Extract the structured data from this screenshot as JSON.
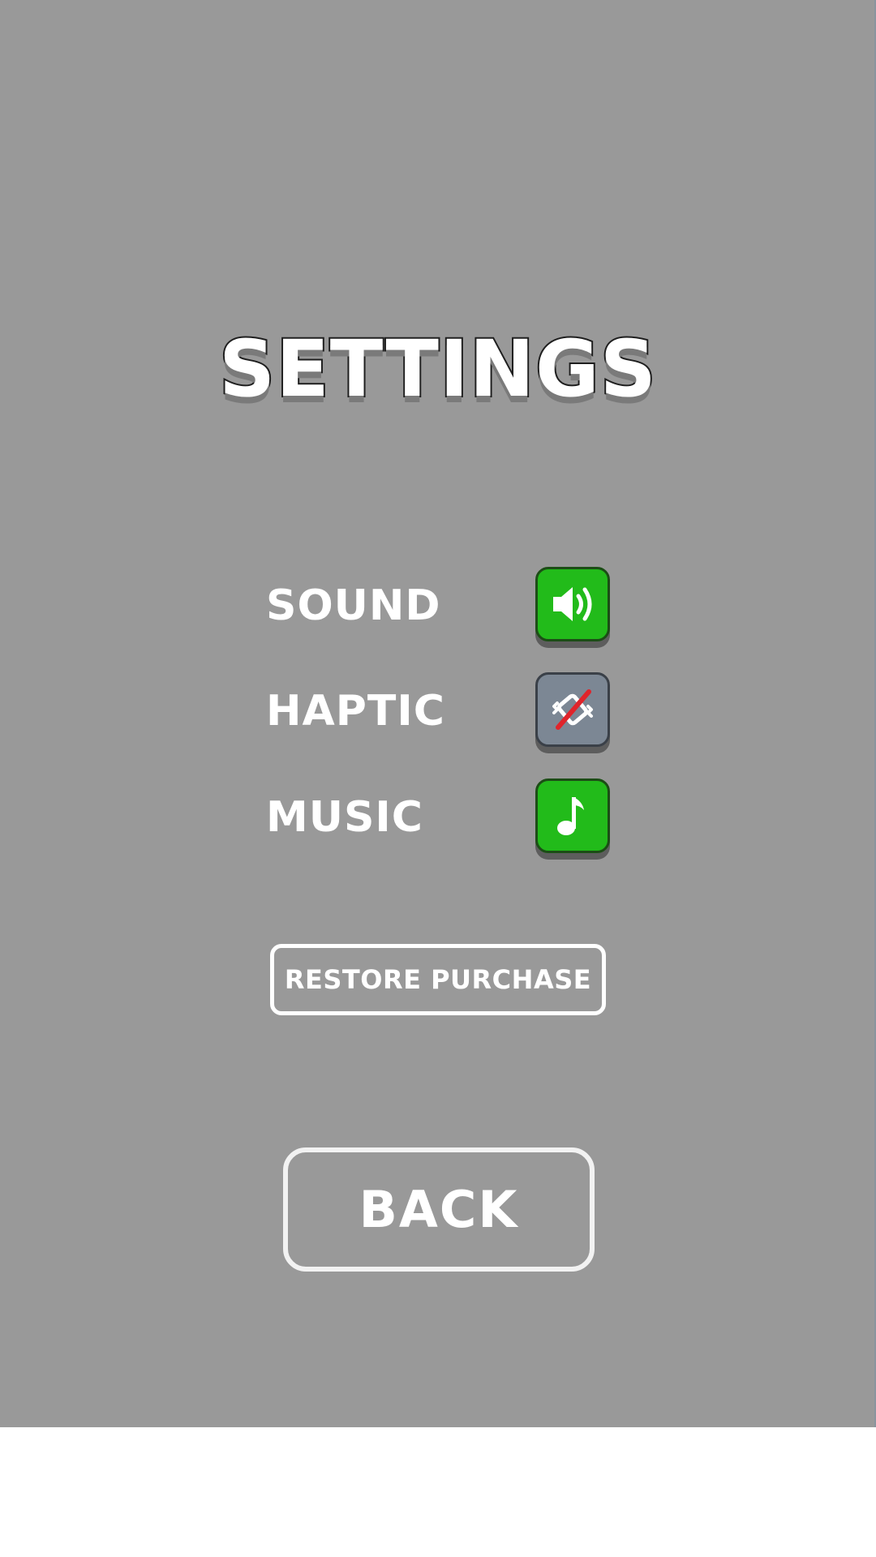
{
  "title": "SETTINGS",
  "settings": [
    {
      "label": "SOUND",
      "state": "on",
      "icon": "speaker-icon"
    },
    {
      "label": "HAPTIC",
      "state": "off",
      "icon": "vibration-off-icon"
    },
    {
      "label": "MUSIC",
      "state": "on",
      "icon": "music-note-icon"
    }
  ],
  "restore_label": "RESTORE PURCHASE",
  "back_label": "BACK",
  "colors": {
    "background": "#999999",
    "toggle_on": "#22bb1a",
    "toggle_off": "#7c8794",
    "disabled_slash": "#e0242b",
    "text": "#ffffff"
  }
}
